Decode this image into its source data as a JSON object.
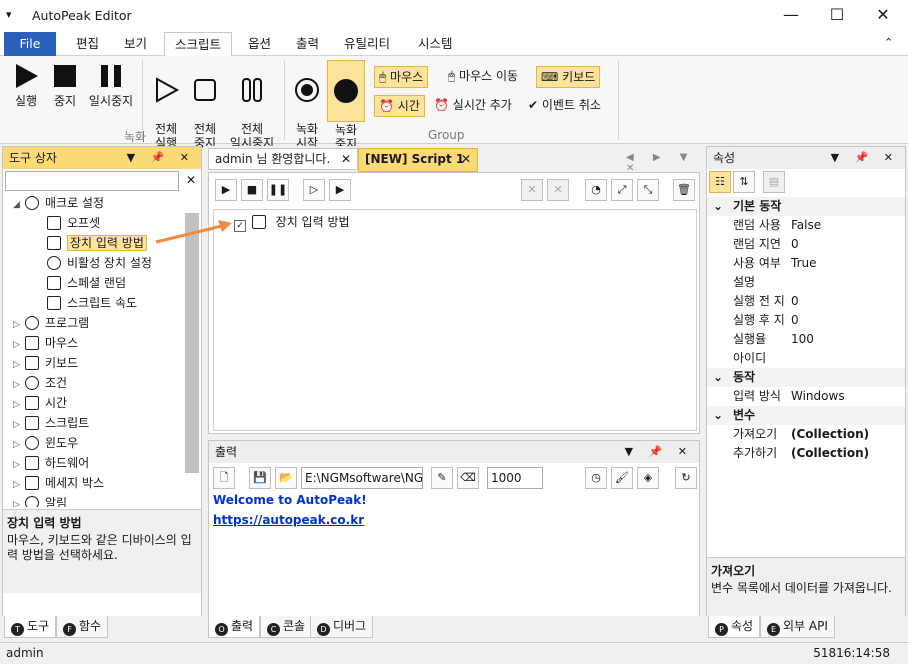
{
  "window": {
    "title": "AutoPeak Editor",
    "menu_glyph": "▾",
    "minimize": "—",
    "maximize": "☐",
    "close": "✕"
  },
  "ribbon_tabs": [
    "File",
    "편집",
    "보기",
    "스크립트",
    "옵션",
    "출력",
    "유틸리티",
    "시스템"
  ],
  "ribbon": {
    "collapse_glyph": "⌃",
    "group_record_label": "녹화",
    "group_group_label": "Group",
    "buttons": {
      "run": "실행",
      "stop": "중지",
      "pause": "일시중지",
      "run_all": "전체\n실행",
      "stop_all": "전체\n중지",
      "pause_all": "전체\n일시중지",
      "record_start": "녹화\n시작",
      "record_stop": "녹화\n중지"
    },
    "options": {
      "mouse": "마우스",
      "mouse_move": "마우스 이동",
      "keyboard": "키보드",
      "time": "시간",
      "realtime_add": "실시간 추가",
      "event_cancel": "이벤트 취소"
    }
  },
  "toolbox": {
    "title": "도구 상자",
    "tree": [
      {
        "label": "매크로 설정",
        "level": 0,
        "expanded": true
      },
      {
        "label": "오프셋",
        "level": 1
      },
      {
        "label": "장치 입력 방법",
        "level": 1,
        "selected": true
      },
      {
        "label": "비활성 장치 설정",
        "level": 1
      },
      {
        "label": "스페셜 랜덤",
        "level": 1
      },
      {
        "label": "스크립트 속도",
        "level": 1
      },
      {
        "label": "프로그램",
        "level": 0
      },
      {
        "label": "마우스",
        "level": 0
      },
      {
        "label": "키보드",
        "level": 0
      },
      {
        "label": "조건",
        "level": 0
      },
      {
        "label": "시간",
        "level": 0
      },
      {
        "label": "스크립트",
        "level": 0
      },
      {
        "label": "윈도우",
        "level": 0
      },
      {
        "label": "하드웨어",
        "level": 0
      },
      {
        "label": "메세지 박스",
        "level": 0
      },
      {
        "label": "알림",
        "level": 0
      }
    ],
    "desc_title": "장치 입력 방법",
    "desc_text": "마우스, 키보드와 같은 디바이스의 입력 방법을 선택하세요.",
    "bottom_tabs": [
      {
        "badge": "T",
        "label": "도구"
      },
      {
        "badge": "F",
        "label": "함수"
      }
    ]
  },
  "editor": {
    "tabs": [
      {
        "label": "admin 님 환영합니다."
      },
      {
        "label": "[NEW] Script 1"
      }
    ],
    "script_lines": [
      "장치 입력 방법"
    ]
  },
  "output": {
    "title": "출력",
    "path": "E:\\NGMsoftware\\NG",
    "count": "1000",
    "lines": [
      "Welcome to AutoPeak!",
      "https://autopeak.co.kr"
    ],
    "bottom_tabs": [
      {
        "badge": "O",
        "label": "출력"
      },
      {
        "badge": "C",
        "label": "콘솔"
      },
      {
        "badge": "D",
        "label": "디버그"
      }
    ]
  },
  "properties": {
    "title": "속성",
    "categories": [
      {
        "name": "기본 동작",
        "rows": [
          {
            "k": "랜덤 사용",
            "v": "False"
          },
          {
            "k": "랜덤 지연",
            "v": "0"
          },
          {
            "k": "사용 여부",
            "v": "True"
          },
          {
            "k": "설명",
            "v": ""
          },
          {
            "k": "실행 전 지",
            "v": "0"
          },
          {
            "k": "실행 후 지",
            "v": "0"
          },
          {
            "k": "실행율",
            "v": "100"
          },
          {
            "k": "아이디",
            "v": ""
          }
        ]
      },
      {
        "name": "동작",
        "rows": [
          {
            "k": "입력 방식",
            "v": "Windows"
          }
        ]
      },
      {
        "name": "변수",
        "rows": [
          {
            "k": "가져오기",
            "v": "(Collection)",
            "bold": true
          },
          {
            "k": "추가하기",
            "v": "(Collection)",
            "bold": true
          }
        ]
      }
    ],
    "desc_title": "가져오기",
    "desc_text": "변수 목록에서 데이터를 가져옵니다.",
    "bottom_tabs": [
      {
        "badge": "P",
        "label": "속성"
      },
      {
        "badge": "E",
        "label": "외부 API"
      }
    ]
  },
  "status": {
    "user": "admin",
    "clock": "51816:14:58"
  },
  "colors": {
    "accent": "#2b5fbc",
    "panel_header": "#fbd975",
    "link": "#0033cc",
    "arrow": "#f08a3c"
  }
}
